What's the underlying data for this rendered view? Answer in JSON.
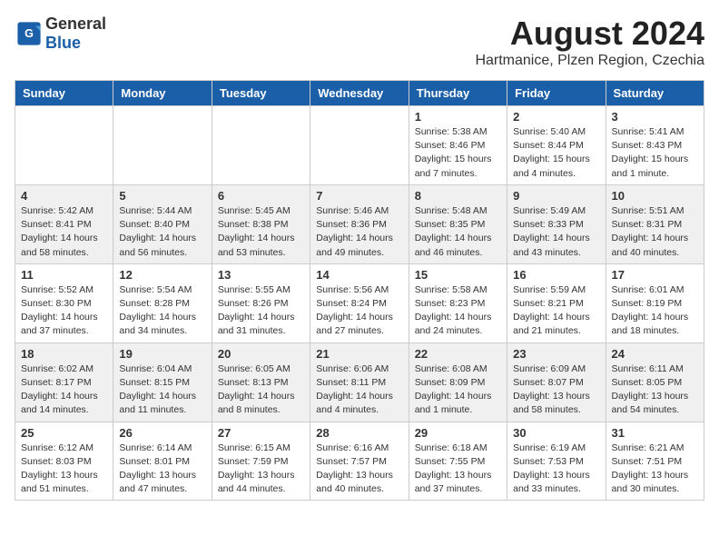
{
  "header": {
    "logo_general": "General",
    "logo_blue": "Blue",
    "month_year": "August 2024",
    "location": "Hartmanice, Plzen Region, Czechia"
  },
  "weekdays": [
    "Sunday",
    "Monday",
    "Tuesday",
    "Wednesday",
    "Thursday",
    "Friday",
    "Saturday"
  ],
  "weeks": [
    [
      {
        "day": "",
        "info": ""
      },
      {
        "day": "",
        "info": ""
      },
      {
        "day": "",
        "info": ""
      },
      {
        "day": "",
        "info": ""
      },
      {
        "day": "1",
        "info": "Sunrise: 5:38 AM\nSunset: 8:46 PM\nDaylight: 15 hours\nand 7 minutes."
      },
      {
        "day": "2",
        "info": "Sunrise: 5:40 AM\nSunset: 8:44 PM\nDaylight: 15 hours\nand 4 minutes."
      },
      {
        "day": "3",
        "info": "Sunrise: 5:41 AM\nSunset: 8:43 PM\nDaylight: 15 hours\nand 1 minute."
      }
    ],
    [
      {
        "day": "4",
        "info": "Sunrise: 5:42 AM\nSunset: 8:41 PM\nDaylight: 14 hours\nand 58 minutes."
      },
      {
        "day": "5",
        "info": "Sunrise: 5:44 AM\nSunset: 8:40 PM\nDaylight: 14 hours\nand 56 minutes."
      },
      {
        "day": "6",
        "info": "Sunrise: 5:45 AM\nSunset: 8:38 PM\nDaylight: 14 hours\nand 53 minutes."
      },
      {
        "day": "7",
        "info": "Sunrise: 5:46 AM\nSunset: 8:36 PM\nDaylight: 14 hours\nand 49 minutes."
      },
      {
        "day": "8",
        "info": "Sunrise: 5:48 AM\nSunset: 8:35 PM\nDaylight: 14 hours\nand 46 minutes."
      },
      {
        "day": "9",
        "info": "Sunrise: 5:49 AM\nSunset: 8:33 PM\nDaylight: 14 hours\nand 43 minutes."
      },
      {
        "day": "10",
        "info": "Sunrise: 5:51 AM\nSunset: 8:31 PM\nDaylight: 14 hours\nand 40 minutes."
      }
    ],
    [
      {
        "day": "11",
        "info": "Sunrise: 5:52 AM\nSunset: 8:30 PM\nDaylight: 14 hours\nand 37 minutes."
      },
      {
        "day": "12",
        "info": "Sunrise: 5:54 AM\nSunset: 8:28 PM\nDaylight: 14 hours\nand 34 minutes."
      },
      {
        "day": "13",
        "info": "Sunrise: 5:55 AM\nSunset: 8:26 PM\nDaylight: 14 hours\nand 31 minutes."
      },
      {
        "day": "14",
        "info": "Sunrise: 5:56 AM\nSunset: 8:24 PM\nDaylight: 14 hours\nand 27 minutes."
      },
      {
        "day": "15",
        "info": "Sunrise: 5:58 AM\nSunset: 8:23 PM\nDaylight: 14 hours\nand 24 minutes."
      },
      {
        "day": "16",
        "info": "Sunrise: 5:59 AM\nSunset: 8:21 PM\nDaylight: 14 hours\nand 21 minutes."
      },
      {
        "day": "17",
        "info": "Sunrise: 6:01 AM\nSunset: 8:19 PM\nDaylight: 14 hours\nand 18 minutes."
      }
    ],
    [
      {
        "day": "18",
        "info": "Sunrise: 6:02 AM\nSunset: 8:17 PM\nDaylight: 14 hours\nand 14 minutes."
      },
      {
        "day": "19",
        "info": "Sunrise: 6:04 AM\nSunset: 8:15 PM\nDaylight: 14 hours\nand 11 minutes."
      },
      {
        "day": "20",
        "info": "Sunrise: 6:05 AM\nSunset: 8:13 PM\nDaylight: 14 hours\nand 8 minutes."
      },
      {
        "day": "21",
        "info": "Sunrise: 6:06 AM\nSunset: 8:11 PM\nDaylight: 14 hours\nand 4 minutes."
      },
      {
        "day": "22",
        "info": "Sunrise: 6:08 AM\nSunset: 8:09 PM\nDaylight: 14 hours\nand 1 minute."
      },
      {
        "day": "23",
        "info": "Sunrise: 6:09 AM\nSunset: 8:07 PM\nDaylight: 13 hours\nand 58 minutes."
      },
      {
        "day": "24",
        "info": "Sunrise: 6:11 AM\nSunset: 8:05 PM\nDaylight: 13 hours\nand 54 minutes."
      }
    ],
    [
      {
        "day": "25",
        "info": "Sunrise: 6:12 AM\nSunset: 8:03 PM\nDaylight: 13 hours\nand 51 minutes."
      },
      {
        "day": "26",
        "info": "Sunrise: 6:14 AM\nSunset: 8:01 PM\nDaylight: 13 hours\nand 47 minutes."
      },
      {
        "day": "27",
        "info": "Sunrise: 6:15 AM\nSunset: 7:59 PM\nDaylight: 13 hours\nand 44 minutes."
      },
      {
        "day": "28",
        "info": "Sunrise: 6:16 AM\nSunset: 7:57 PM\nDaylight: 13 hours\nand 40 minutes."
      },
      {
        "day": "29",
        "info": "Sunrise: 6:18 AM\nSunset: 7:55 PM\nDaylight: 13 hours\nand 37 minutes."
      },
      {
        "day": "30",
        "info": "Sunrise: 6:19 AM\nSunset: 7:53 PM\nDaylight: 13 hours\nand 33 minutes."
      },
      {
        "day": "31",
        "info": "Sunrise: 6:21 AM\nSunset: 7:51 PM\nDaylight: 13 hours\nand 30 minutes."
      }
    ]
  ]
}
